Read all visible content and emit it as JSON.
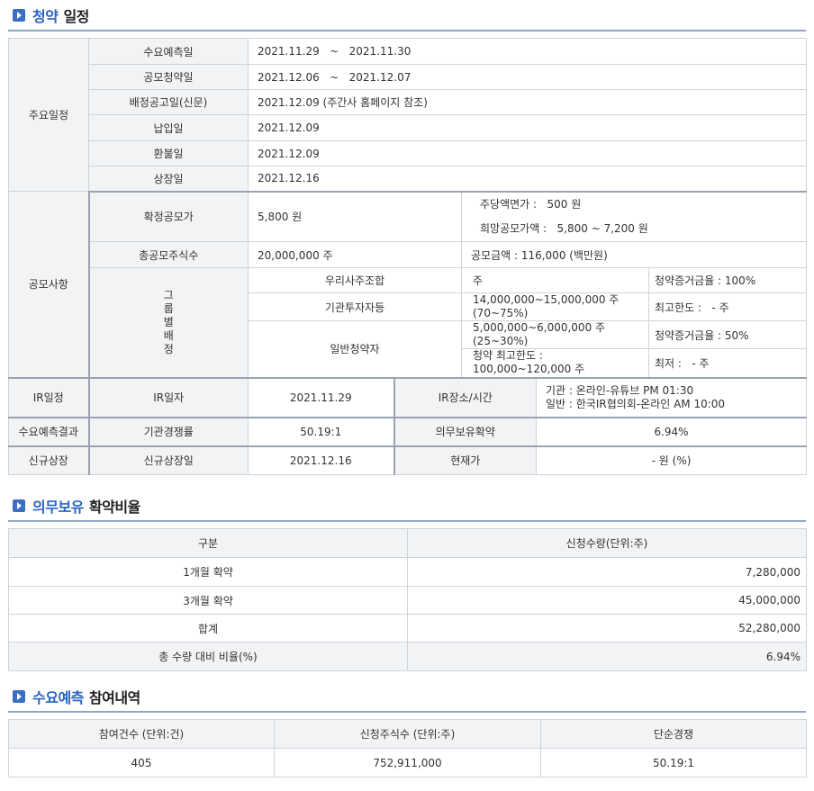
{
  "sections": {
    "schedule": {
      "accent": "청약",
      "rest": "일정"
    },
    "lockup": {
      "accent": "의무보유",
      "rest": "확약비율"
    },
    "demand": {
      "accent": "수요예측",
      "rest": "참여내역"
    }
  },
  "schedule": {
    "group_main": "주요일정",
    "rows": [
      {
        "label": "수요예측일",
        "value": "2021.11.29   ~   2021.11.30"
      },
      {
        "label": "공모청약일",
        "value": "2021.12.06   ~   2021.12.07"
      },
      {
        "label": "배정공고일(신문)",
        "value": "2021.12.09 (주간사 홈페이지 참조)"
      },
      {
        "label": "납입일",
        "value": "2021.12.09"
      },
      {
        "label": "환불일",
        "value": "2021.12.09"
      },
      {
        "label": "상장일",
        "value": "2021.12.16"
      }
    ],
    "group_offer": "공모사항",
    "confirmed_price_label": "확정공모가",
    "confirmed_price": "5,800 원",
    "par_value": "주당액면가 :   500 원",
    "hope_price": "희망공모가액 :   5,800 ~ 7,200 원",
    "total_shares_label": "총공모주식수",
    "total_shares": "20,000,000 주",
    "offer_amount": "공모금액 : 116,000 (백만원)",
    "group_alloc": "그룹별배정",
    "alloc": {
      "employee": "우리사주조합",
      "employee_shares": "주",
      "employee_margin": "청약증거금율 : 100%",
      "inst": "기관투자자등",
      "inst_shares_1": "14,000,000~15,000,000 주",
      "inst_shares_2": "(70~75%)",
      "inst_max": "최고한도 :   - 주",
      "retail": "일반청약자",
      "retail_shares_1": "5,000,000~6,000,000 주",
      "retail_shares_2": "(25~30%)",
      "retail_margin": "청약증거금율 : 50%",
      "retail_limit_1": "청약 최고한도 :",
      "retail_limit_2": "100,000~120,000 주",
      "retail_min": "최저 :   - 주"
    },
    "ir_group": "IR일정",
    "ir_date_label": "IR일자",
    "ir_date": "2021.11.29",
    "ir_place_label": "IR장소/시간",
    "ir_place_1": "기관 : 온라인-유튜브 PM 01:30",
    "ir_place_2": "일반 : 한국IR협의회-온라인 AM 10:00",
    "demand_group": "수요예측결과",
    "competition_label": "기관경쟁률",
    "competition": "50.19:1",
    "lockup_label": "의무보유확약",
    "lockup_value": "6.94%",
    "listing_group": "신규상장",
    "listing_date_label": "신규상장일",
    "listing_date": "2021.12.16",
    "current_price_label": "현재가",
    "current_price": "- 원 (%)"
  },
  "lockup_table": {
    "headers": [
      "구분",
      "신청수량(단위:주)"
    ],
    "rows": [
      [
        "1개월 확약",
        "7,280,000"
      ],
      [
        "3개월 확약",
        "45,000,000"
      ],
      [
        "합계",
        "52,280,000"
      ],
      [
        "총 수량 대비 비율(%)",
        "6.94%"
      ]
    ]
  },
  "demand_table": {
    "headers": [
      "참여건수 (단위:건)",
      "신청주식수 (단위:주)",
      "단순경쟁"
    ],
    "row": [
      "405",
      "752,911,000",
      "50.19:1"
    ]
  }
}
